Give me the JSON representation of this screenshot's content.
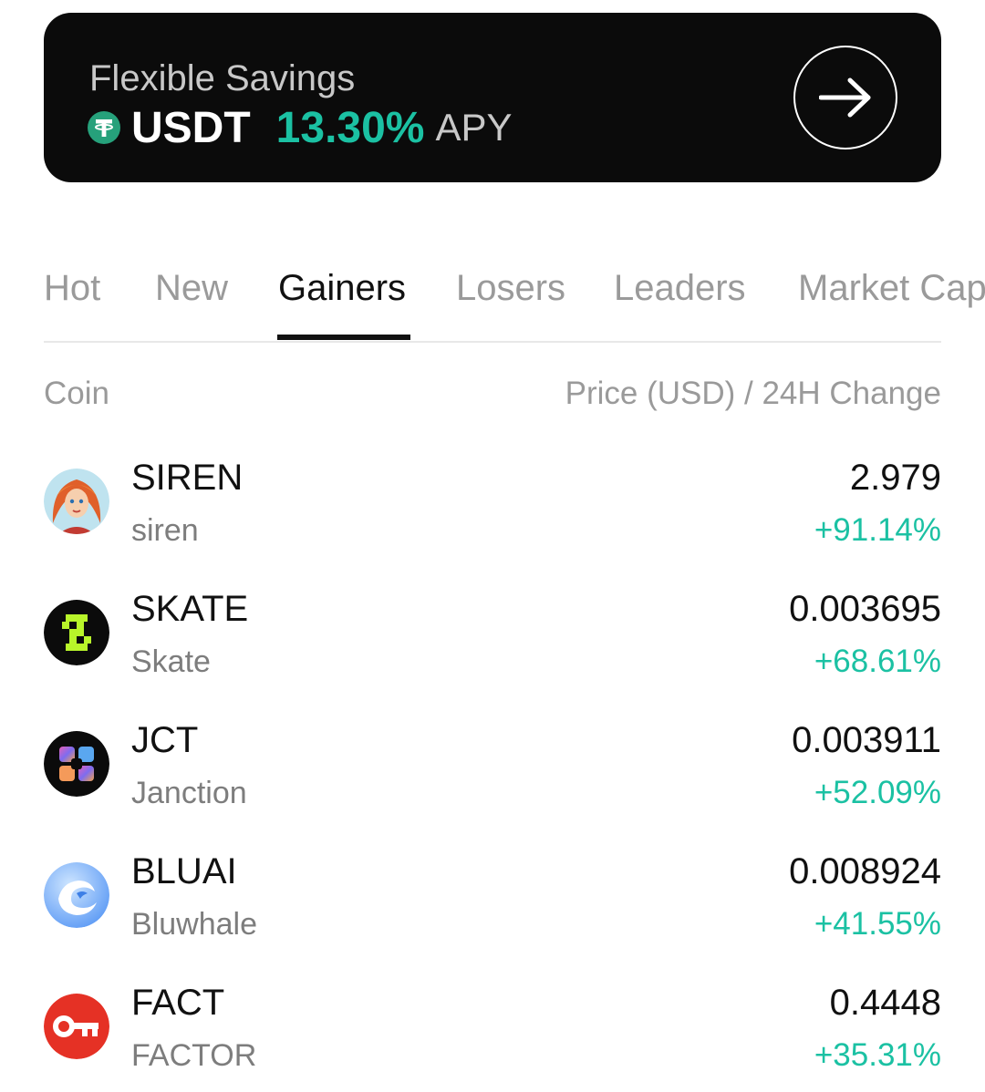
{
  "colors": {
    "positive": "#1bc1a3",
    "usdt_green": "#26a17b",
    "banner_bg": "#0b0b0b"
  },
  "banner": {
    "title": "Flexible Savings",
    "coin": "USDT",
    "rate": "13.30%",
    "rate_suffix": "APY",
    "coin_icon": "usdt-icon",
    "action_icon": "arrow-right-icon"
  },
  "tabs": [
    {
      "label": "Hot",
      "active": false
    },
    {
      "label": "New",
      "active": false
    },
    {
      "label": "Gainers",
      "active": true
    },
    {
      "label": "Losers",
      "active": false
    },
    {
      "label": "Leaders",
      "active": false
    },
    {
      "label": "Market Cap",
      "active": false
    }
  ],
  "list": {
    "header": {
      "coin": "Coin",
      "price": "Price (USD) / 24H Change"
    },
    "rows": [
      {
        "symbol": "SIREN",
        "name": "siren",
        "price": "2.979",
        "change": "+91.14%",
        "icon": "siren-icon"
      },
      {
        "symbol": "SKATE",
        "name": "Skate",
        "price": "0.003695",
        "change": "+68.61%",
        "icon": "skate-icon"
      },
      {
        "symbol": "JCT",
        "name": "Janction",
        "price": "0.003911",
        "change": "+52.09%",
        "icon": "jct-icon"
      },
      {
        "symbol": "BLUAI",
        "name": "Bluwhale",
        "price": "0.008924",
        "change": "+41.55%",
        "icon": "bluai-icon"
      },
      {
        "symbol": "FACT",
        "name": "FACTOR",
        "price": "0.4448",
        "change": "+35.31%",
        "icon": "fact-key-icon"
      }
    ]
  }
}
